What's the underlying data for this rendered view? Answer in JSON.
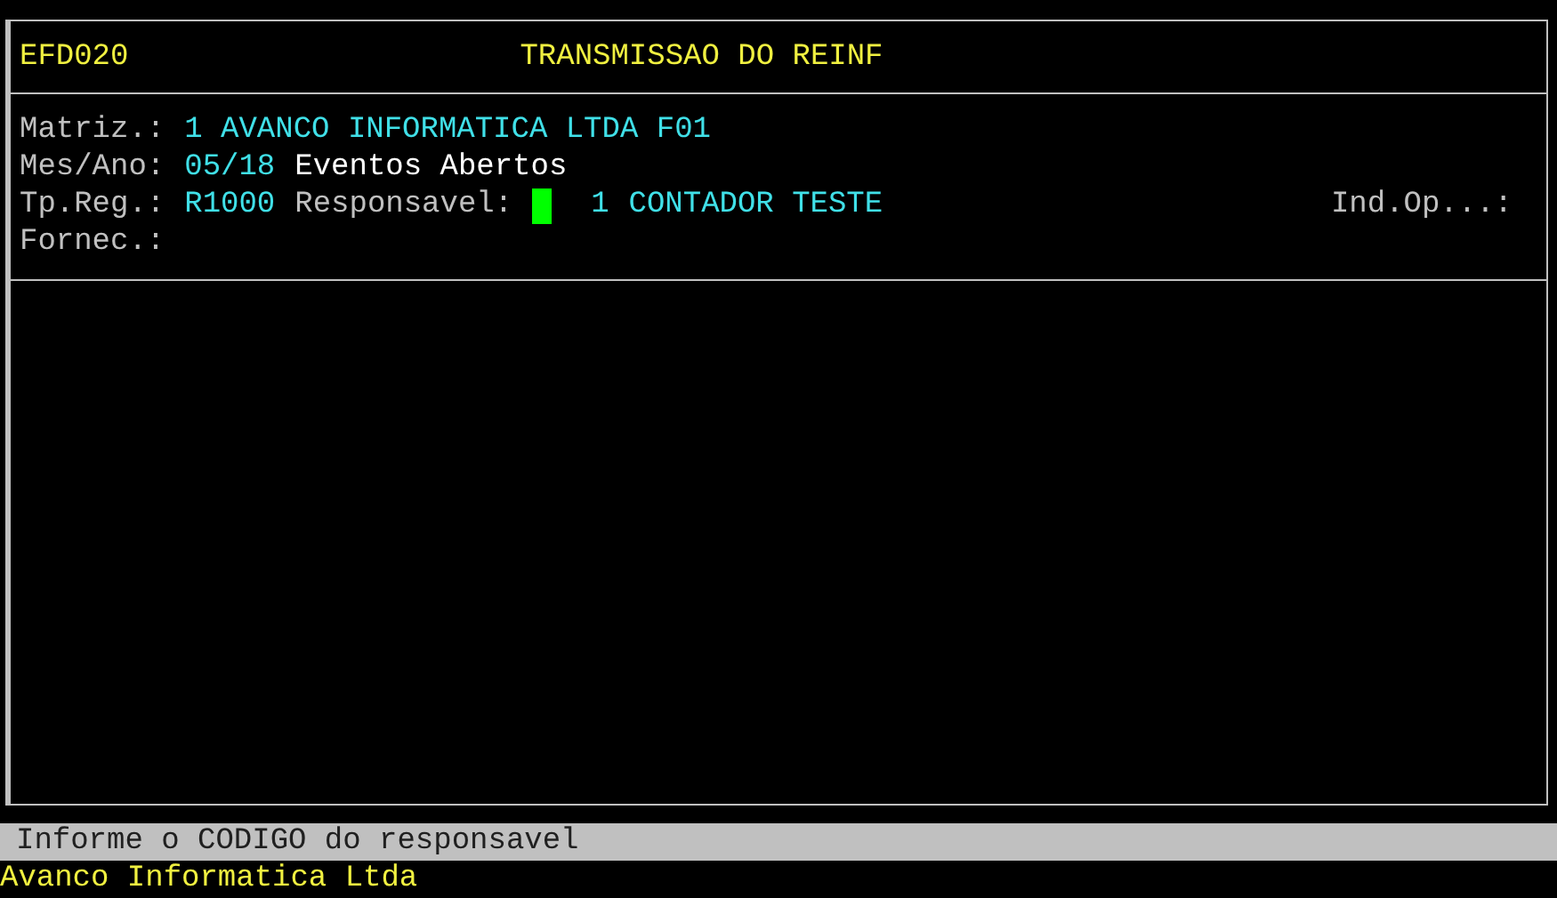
{
  "header": {
    "program_code": "EFD020",
    "title": "TRANSMISSAO DO REINF"
  },
  "form_rows": [
    {
      "segments": [
        {
          "kind": "label",
          "text": "Matriz.:"
        },
        {
          "kind": "value",
          "text": "1 AVANCO INFORMATICA LTDA F01"
        }
      ]
    },
    {
      "segments": [
        {
          "kind": "label",
          "text": "Mes/Ano:"
        },
        {
          "kind": "value",
          "text": "05/18"
        },
        {
          "kind": "note",
          "text": "Eventos Abertos"
        }
      ]
    },
    {
      "segments": [
        {
          "kind": "label",
          "text": "Tp.Reg.:"
        },
        {
          "kind": "value",
          "text": "R1000"
        },
        {
          "kind": "label",
          "text": "Responsavel:"
        },
        {
          "kind": "cursor"
        },
        {
          "kind": "value",
          "text": "1"
        },
        {
          "kind": "value",
          "text": "CONTADOR TESTE"
        },
        {
          "kind": "right_label",
          "text": "Ind.Op...:"
        }
      ]
    },
    {
      "segments": [
        {
          "kind": "label",
          "text": "Fornec.:"
        }
      ]
    }
  ],
  "message_bar": "Informe o CODIGO do responsavel",
  "footer": "Avanco Informatica Ltda"
}
